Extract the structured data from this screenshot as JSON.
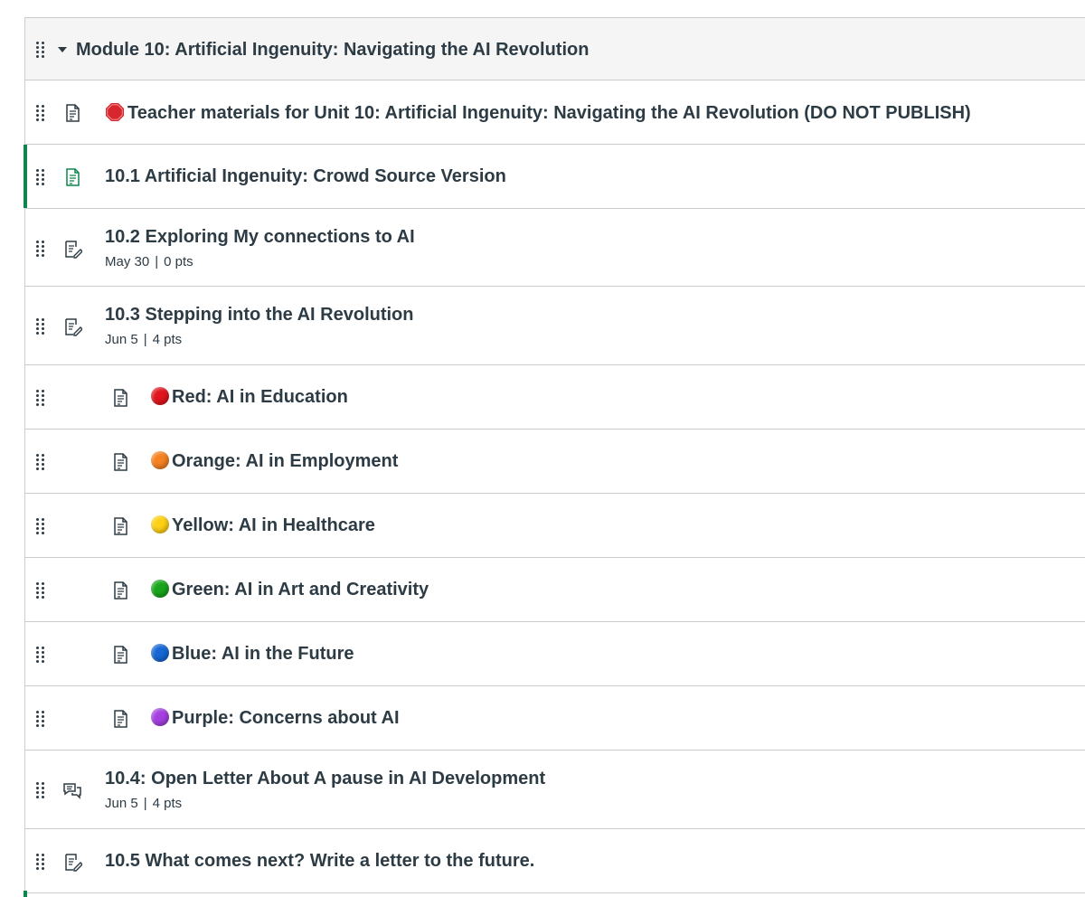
{
  "module": {
    "title": "Module 10: Artificial Ingenuity: Navigating the AI Revolution"
  },
  "colors": {
    "published_accent": "#0b874b",
    "text": "#2d3b45",
    "border": "#c7cdd1"
  },
  "items": [
    {
      "title": "Teacher materials for Unit 10: Artificial Ingenuity: Navigating the AI Revolution (DO NOT PUBLISH)",
      "icon": "page-icon",
      "marker": "stop-sign"
    },
    {
      "title": "10.1 Artificial Ingenuity: Crowd Source Version",
      "icon": "page-icon",
      "published": true
    },
    {
      "title": "10.2 Exploring My connections to AI",
      "icon": "assignment-icon",
      "date": "May 30",
      "points": "0 pts"
    },
    {
      "title": "10.3 Stepping into the AI Revolution",
      "icon": "assignment-icon",
      "date": "Jun 5",
      "points": "4 pts"
    },
    {
      "title": "Red: AI in Education",
      "icon": "page-icon",
      "indent": true,
      "dot_color": "#e0141e"
    },
    {
      "title": "Orange: AI in Employment",
      "icon": "page-icon",
      "indent": true,
      "dot_color": "#f58220"
    },
    {
      "title": "Yellow: AI in Healthcare",
      "icon": "page-icon",
      "indent": true,
      "dot_color": "#fdd016"
    },
    {
      "title": "Green: AI in Art and Creativity",
      "icon": "page-icon",
      "indent": true,
      "dot_color": "#19a51b"
    },
    {
      "title": "Blue: AI in the Future",
      "icon": "page-icon",
      "indent": true,
      "dot_color": "#1667d4"
    },
    {
      "title": "Purple: Concerns about AI",
      "icon": "page-icon",
      "indent": true,
      "dot_color": "#a53fe0"
    },
    {
      "title": "10.4: Open Letter About A pause in AI Development",
      "icon": "discussion-icon",
      "date": "Jun 5",
      "points": "4 pts"
    },
    {
      "title": "10.5 What comes next? Write a letter to the future.",
      "icon": "assignment-icon"
    }
  ]
}
